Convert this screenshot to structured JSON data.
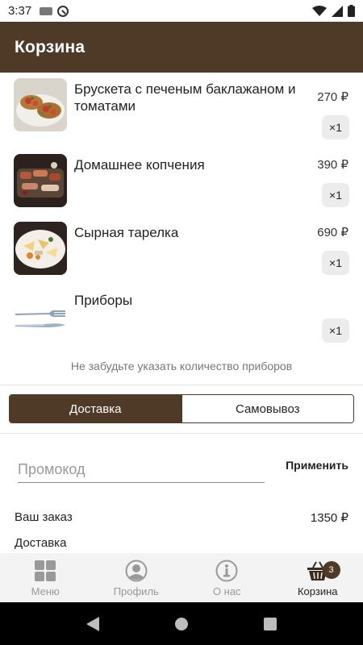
{
  "status_bar": {
    "time": "3:37"
  },
  "app_bar": {
    "title": "Корзина"
  },
  "cart": {
    "items": [
      {
        "name": "Брускета с печеным баклажаном и томатами",
        "price": "270 ₽",
        "qty": "×1"
      },
      {
        "name": "Домашнее копчения",
        "price": "390 ₽",
        "qty": "×1"
      },
      {
        "name": "Сырная тарелка",
        "price": "690 ₽",
        "qty": "×1"
      },
      {
        "name": "Приборы",
        "price": "",
        "qty": "×1"
      }
    ],
    "hint": "Не забудьте указать количество приборов"
  },
  "delivery_toggle": {
    "delivery": "Доставка",
    "pickup": "Самовывоз",
    "selected": "Доставка"
  },
  "promo": {
    "placeholder": "Промокод",
    "value": "",
    "apply_label": "Применить"
  },
  "summary": {
    "order_label": "Ваш заказ",
    "order_total": "1350 ₽",
    "delivery_label": "Доставка"
  },
  "bottom_nav": {
    "items": [
      {
        "label": "Меню",
        "icon": "grid-icon"
      },
      {
        "label": "Профиль",
        "icon": "profile-icon"
      },
      {
        "label": "О нас",
        "icon": "info-icon"
      },
      {
        "label": "Корзина",
        "icon": "basket-icon",
        "badge": "3"
      }
    ],
    "active": "Корзина"
  },
  "colors": {
    "brand": "#4e3a26",
    "inactive": "#999999"
  }
}
